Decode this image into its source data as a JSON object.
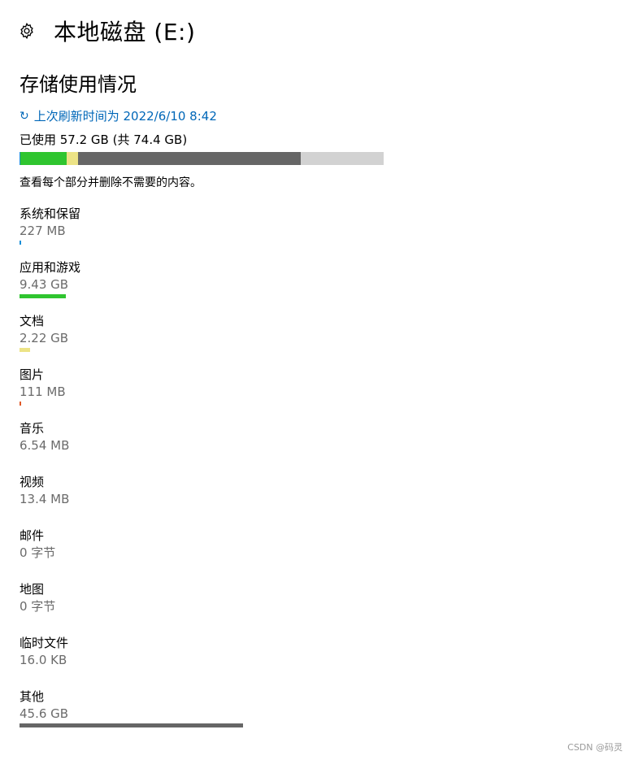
{
  "header": {
    "title": "本地磁盘 (E:)",
    "icon": "gear-icon"
  },
  "section_title": "存储使用情况",
  "refresh": {
    "icon": "refresh-icon",
    "glyph": "↻",
    "label": "上次刷新时间为 2022/6/10 8:42",
    "color": "#0067b8"
  },
  "usage": {
    "label": "已使用 57.2 GB (共 74.4 GB)",
    "used_gb": 57.2,
    "total_gb": 74.4,
    "segments": [
      {
        "name": "系统和保留",
        "gb": 0.227,
        "color": "#1a8fd8"
      },
      {
        "name": "应用和游戏",
        "gb": 9.43,
        "color": "#2fc52f"
      },
      {
        "name": "文档",
        "gb": 2.22,
        "color": "#ece386"
      },
      {
        "name": "其他",
        "gb": 45.6,
        "color": "#666666"
      }
    ],
    "free_color": "#d2d2d2"
  },
  "hint": "查看每个部分并删除不需要的内容。",
  "categories": [
    {
      "name": "系统和保留",
      "size": "227 MB",
      "fraction": 0.002,
      "color": "#1a8fd8"
    },
    {
      "name": "应用和游戏",
      "size": "9.43 GB",
      "fraction": 0.127,
      "color": "#2fc52f"
    },
    {
      "name": "文档",
      "size": "2.22 GB",
      "fraction": 0.03,
      "color": "#ece386"
    },
    {
      "name": "图片",
      "size": "111 MB",
      "fraction": 0.0015,
      "color": "#e05a2a"
    },
    {
      "name": "音乐",
      "size": "6.54 MB",
      "fraction": 0,
      "color": "#888888"
    },
    {
      "name": "视频",
      "size": "13.4 MB",
      "fraction": 0,
      "color": "#888888"
    },
    {
      "name": "邮件",
      "size": "0 字节",
      "fraction": 0,
      "color": "#888888"
    },
    {
      "name": "地图",
      "size": "0 字节",
      "fraction": 0,
      "color": "#888888"
    },
    {
      "name": "临时文件",
      "size": "16.0 KB",
      "fraction": 0,
      "color": "#888888"
    },
    {
      "name": "其他",
      "size": "45.6 GB",
      "fraction": 0.613,
      "color": "#666666"
    }
  ],
  "watermark": "CSDN @码灵"
}
